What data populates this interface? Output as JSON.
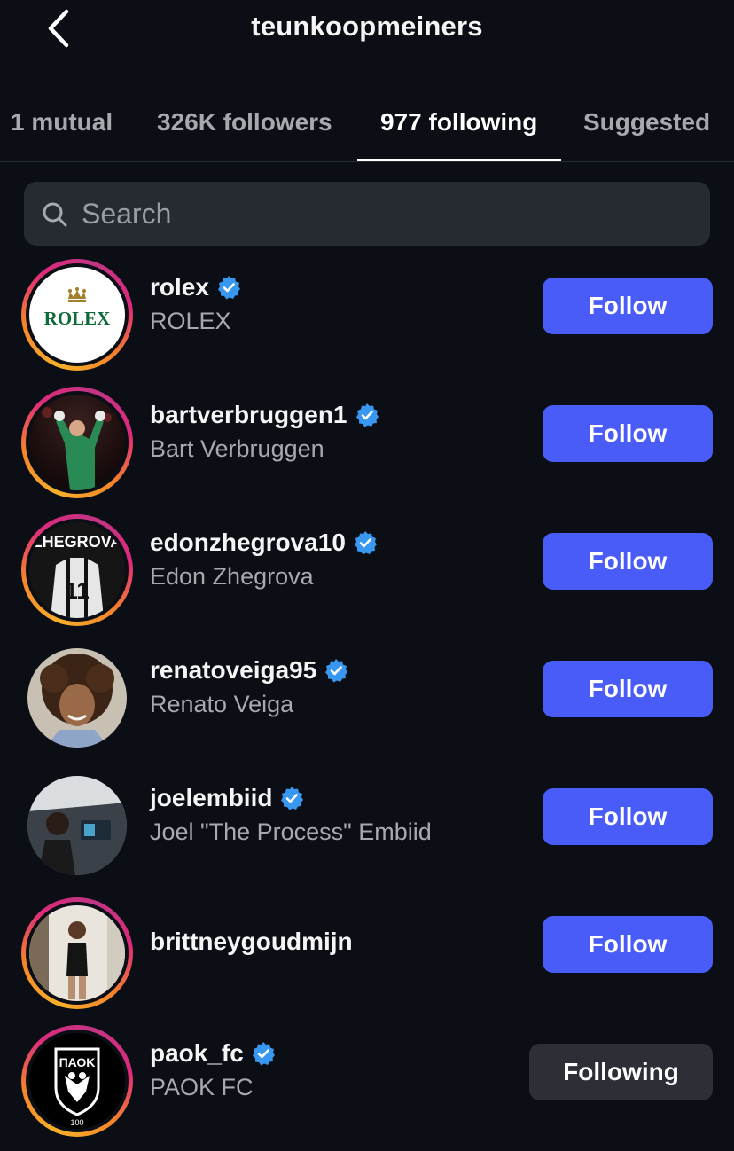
{
  "header": {
    "title": "teunkoopmeiners",
    "back_icon": "chevron-left-icon"
  },
  "tabs": [
    {
      "label": "1 mutual",
      "active": false
    },
    {
      "label": "326K followers",
      "active": false
    },
    {
      "label": "977 following",
      "active": true
    },
    {
      "label": "Suggested",
      "active": false
    }
  ],
  "search": {
    "placeholder": "Search",
    "icon": "search-icon"
  },
  "accounts": [
    {
      "username": "rolex",
      "full_name": "ROLEX",
      "verified": true,
      "button": "Follow",
      "story_ring": true,
      "avatar_text": "ROLEX"
    },
    {
      "username": "bartverbruggen1",
      "full_name": "Bart Verbruggen",
      "verified": true,
      "button": "Follow",
      "story_ring": true
    },
    {
      "username": "edonzhegrova10",
      "full_name": "Edon Zhegrova",
      "verified": true,
      "button": "Follow",
      "story_ring": true,
      "avatar_text": "ZHEGROVA",
      "avatar_number": "11"
    },
    {
      "username": "renatoveiga95",
      "full_name": "Renato Veiga",
      "verified": true,
      "button": "Follow",
      "story_ring": false
    },
    {
      "username": "joelembiid",
      "full_name": "Joel \"The Process\" Embiid",
      "verified": true,
      "button": "Follow",
      "story_ring": false
    },
    {
      "username": "brittneygoudmijn",
      "full_name": "",
      "verified": false,
      "button": "Follow",
      "story_ring": true
    },
    {
      "username": "paok_fc",
      "full_name": "PAOK FC",
      "verified": true,
      "button": "Following",
      "story_ring": true,
      "avatar_text": "ΠΑΟΚ",
      "avatar_number": "100"
    }
  ],
  "colors": {
    "background": "#0b0e14",
    "follow_button": "#4a5cf7",
    "following_button": "#2c3036",
    "verified_badge": "#3897f0"
  }
}
